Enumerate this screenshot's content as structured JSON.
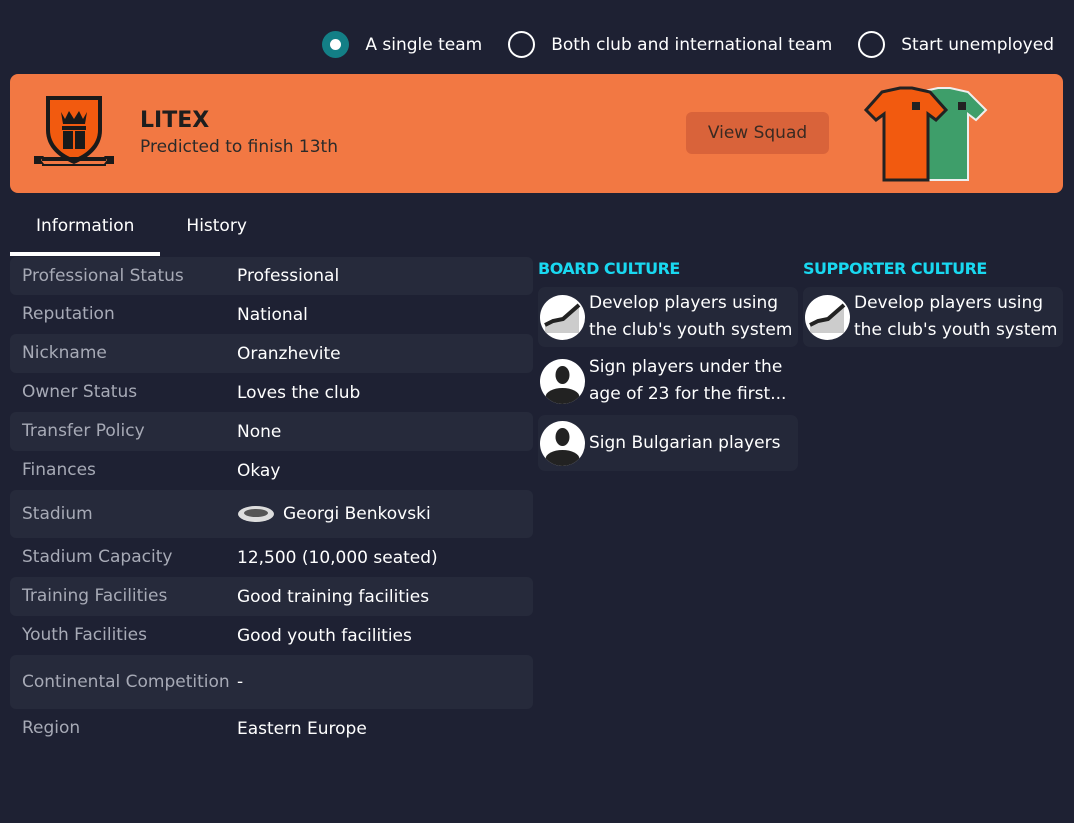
{
  "mode_options": [
    {
      "label": "A single team",
      "selected": true
    },
    {
      "label": "Both club and international team",
      "selected": false
    },
    {
      "label": "Start unemployed",
      "selected": false
    }
  ],
  "club": {
    "name": "LITEX",
    "prediction": "Predicted to finish 13th",
    "view_squad": "View Squad",
    "banner_color": "#f27843",
    "home_kit_color": "#f25a0f",
    "away_kit_color": "#3e9e6a"
  },
  "tabs": [
    {
      "label": "Information",
      "active": true
    },
    {
      "label": "History",
      "active": false
    }
  ],
  "info": [
    {
      "label": "Professional Status",
      "value": "Professional"
    },
    {
      "label": "Reputation",
      "value": "National"
    },
    {
      "label": "Nickname",
      "value": "Oranzhevite"
    },
    {
      "label": "Owner Status",
      "value": "Loves the club"
    },
    {
      "label": "Transfer Policy",
      "value": "None"
    },
    {
      "label": "Finances",
      "value": "Okay"
    },
    {
      "label": "Stadium",
      "value": "Georgi Benkovski",
      "icon": "stadium-icon"
    },
    {
      "label": "Stadium Capacity",
      "value": "12,500 (10,000 seated)"
    },
    {
      "label": "Training Facilities",
      "value": "Good training facilities"
    },
    {
      "label": "Youth Facilities",
      "value": "Good youth facilities"
    },
    {
      "label": "Continental Competition",
      "value": "-"
    },
    {
      "label": "Region",
      "value": "Eastern Europe"
    }
  ],
  "board_culture": {
    "title": "BOARD CULTURE",
    "items": [
      {
        "text": "Develop players using the club's youth system",
        "icon": "growth-chart-icon"
      },
      {
        "text": "Sign players under the age of 23 for the first...",
        "icon": "player-icon"
      },
      {
        "text": "Sign Bulgarian players",
        "icon": "player-icon"
      }
    ]
  },
  "supporter_culture": {
    "title": "SUPPORTER CULTURE",
    "items": [
      {
        "text": "Develop players using the club's youth system",
        "icon": "growth-chart-icon"
      }
    ]
  },
  "accent_color": "#19d8f0"
}
